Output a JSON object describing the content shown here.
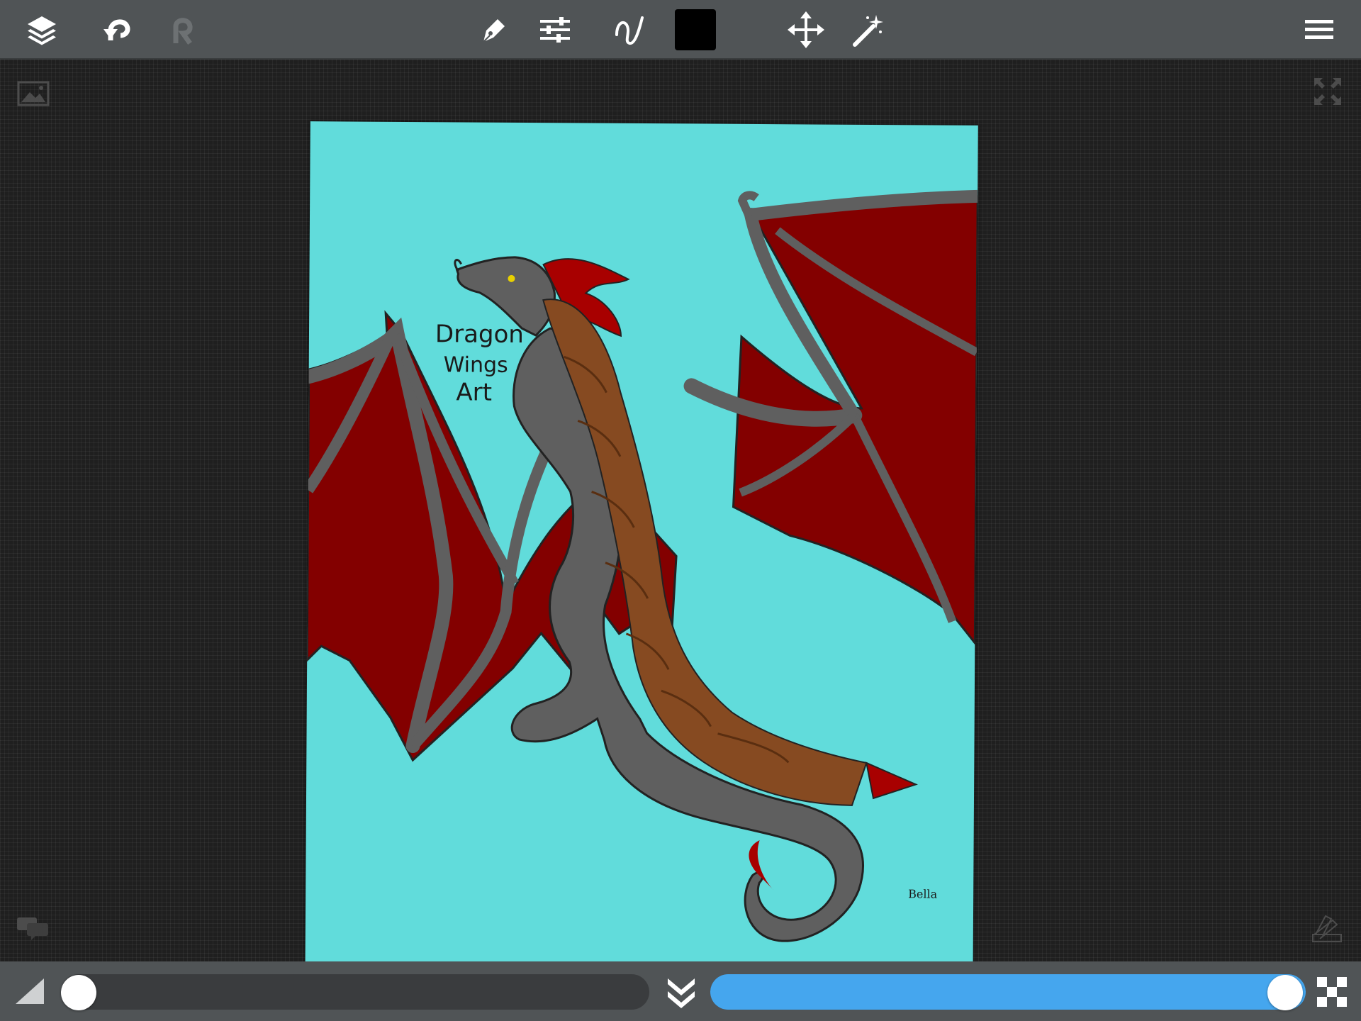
{
  "app": {
    "toolbar": {
      "icons": [
        "layers-icon",
        "undo-icon",
        "redo-icon",
        "pen-tool-icon",
        "adjustments-icon",
        "brush-stroke-icon",
        "color-swatch",
        "move-icon",
        "magic-wand-icon",
        "menu-icon"
      ],
      "current_color": "#000000",
      "redo_enabled": false
    },
    "canvas": {
      "background_color": "#61dcdb",
      "artwork": {
        "caption_lines": [
          "Dragon",
          "Wings",
          "Art"
        ],
        "signature": "Bella"
      }
    },
    "workspace_icons": [
      "reference-image-icon",
      "fullscreen-icon",
      "chat-icon",
      "color-palette-icon"
    ],
    "bottombar": {
      "size_slider": {
        "value": 0.0
      },
      "opacity_slider": {
        "value": 1.0,
        "accent": "#45a6ee"
      },
      "icons": [
        "brush-size-icon",
        "merge-down-icon",
        "transparency-icon"
      ]
    }
  }
}
